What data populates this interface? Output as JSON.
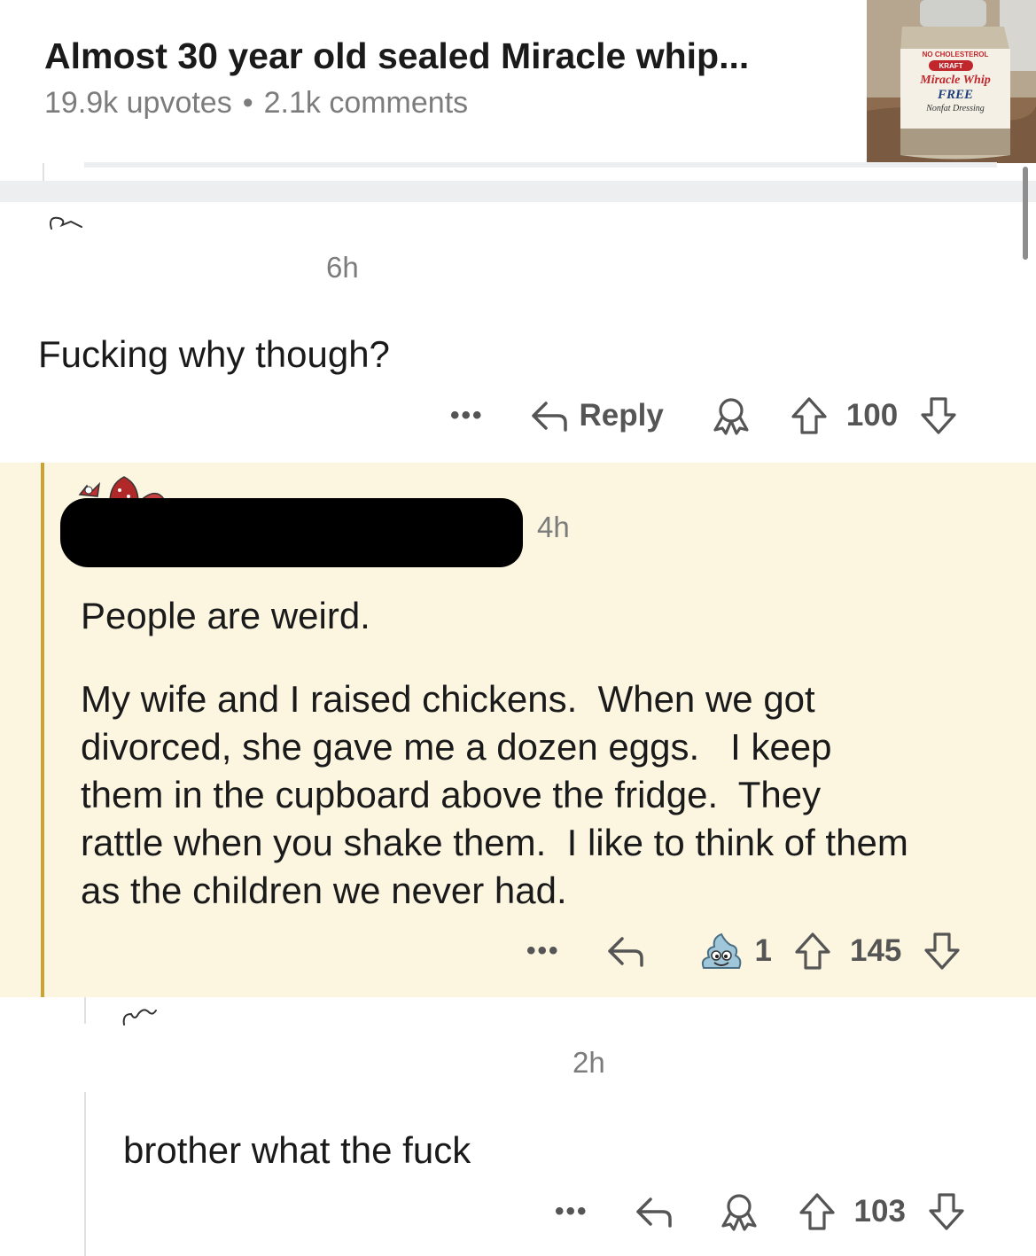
{
  "post": {
    "title": "Almost 30 year old sealed Miracle whip...",
    "upvotes": "19.9k upvotes",
    "separator": "•",
    "comments": "2.1k comments",
    "thumbnail": {
      "label_top": "NO CHOLESTEROL",
      "brand": "KRAFT",
      "product": "Miracle Whip",
      "variant": "FREE",
      "subtitle": "Nonfat Dressing"
    }
  },
  "comments": [
    {
      "age": "6h",
      "body": "Fucking why though?",
      "actions": {
        "more": "•••",
        "reply": "Reply",
        "score": "100"
      }
    },
    {
      "age": "4h",
      "body_lines": [
        "People are weird.",
        "My wife and I raised chickens.  When we got",
        "divorced, she gave me a dozen eggs.   I keep",
        "them in the cupboard above the fridge.  They",
        "rattle when you shake them.  I like to think of them",
        "as the children we never had."
      ],
      "actions": {
        "more": "•••",
        "award_count": "1",
        "score": "145"
      }
    },
    {
      "age": "2h",
      "body": "brother what the fuck",
      "actions": {
        "more": "•••",
        "score": "103"
      }
    }
  ],
  "colors": {
    "highlight_bg": "#fcf6e1",
    "highlight_bar": "#c9a23a",
    "meta_gray": "#7c7c7c",
    "action_gray": "#555555"
  },
  "icons": {
    "reply": "reply-arrow-icon",
    "award": "award-icon",
    "upvote": "upvote-arrow-icon",
    "downvote": "downvote-arrow-icon",
    "poop_award": "poop-award-icon"
  }
}
